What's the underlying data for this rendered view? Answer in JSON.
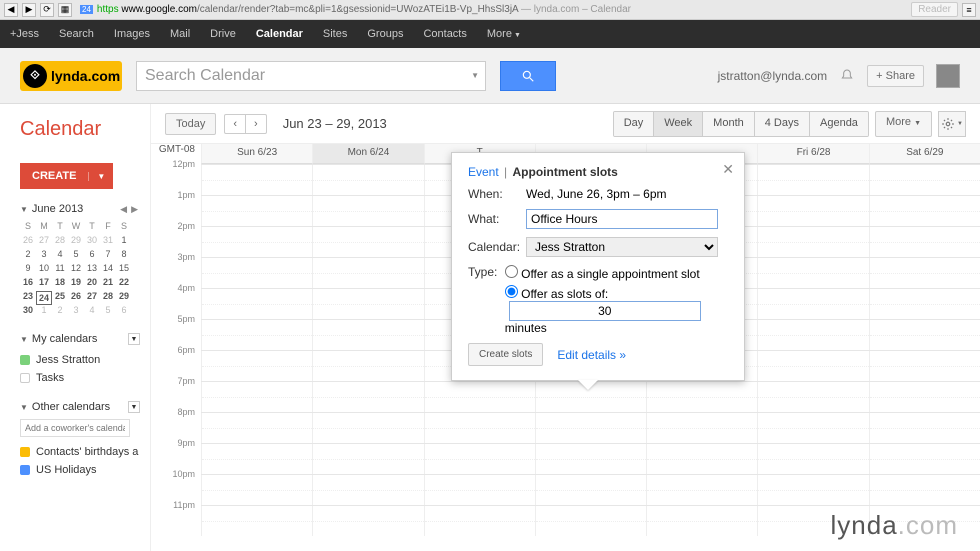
{
  "chrome": {
    "back": "◀",
    "fwd": "▶",
    "reload": "⟳",
    "grid": "▦",
    "favicon": "24",
    "https_label": "https",
    "host": "www.google.com",
    "path": "/calendar/render?tab=mc&pli=1&gsessionid=UWozATEi1B-Vp_HhsSl3jA",
    "title_suffix": " — lynda.com – Calendar",
    "reader": "Reader",
    "menu": "≡"
  },
  "gbar": {
    "items": [
      "+Jess",
      "Search",
      "Images",
      "Mail",
      "Drive",
      "Calendar",
      "Sites",
      "Groups",
      "Contacts"
    ],
    "more": "More"
  },
  "header": {
    "logo_text": "lynda.com",
    "search_placeholder": "Search Calendar",
    "email": "jstratton@lynda.com",
    "share": "+  Share"
  },
  "sidebar": {
    "title": "Calendar",
    "create_label": "CREATE",
    "month_label": "June 2013",
    "dow": [
      "S",
      "M",
      "T",
      "W",
      "T",
      "F",
      "S"
    ],
    "weeks": [
      [
        "26",
        "27",
        "28",
        "29",
        "30",
        "31",
        "1"
      ],
      [
        "2",
        "3",
        "4",
        "5",
        "6",
        "7",
        "8"
      ],
      [
        "9",
        "10",
        "11",
        "12",
        "13",
        "14",
        "15"
      ],
      [
        "16",
        "17",
        "18",
        "19",
        "20",
        "21",
        "22"
      ],
      [
        "23",
        "24",
        "25",
        "26",
        "27",
        "28",
        "29"
      ],
      [
        "30",
        "1",
        "2",
        "3",
        "4",
        "5",
        "6"
      ]
    ],
    "my_cals_label": "My calendars",
    "my_cals": [
      {
        "name": "Jess Stratton",
        "color": "#7bd17b",
        "checked": true
      },
      {
        "name": "Tasks",
        "color": "#ffffff",
        "checked": false
      }
    ],
    "other_cals_label": "Other calendars",
    "add_placeholder": "Add a coworker's calendar",
    "other_cals": [
      {
        "name": "Contacts' birthdays a",
        "color": "#fbbc05"
      },
      {
        "name": "US Holidays",
        "color": "#4d90fe"
      }
    ]
  },
  "toolbar": {
    "today": "Today",
    "prev": "‹",
    "next": "›",
    "range": "Jun 23 – 29, 2013",
    "views": [
      "Day",
      "Week",
      "Month",
      "4 Days",
      "Agenda"
    ],
    "more": "More"
  },
  "grid": {
    "tz": "GMT-08",
    "days": [
      "Sun 6/23",
      "Mon 6/24",
      "T",
      "",
      "",
      "Fri 6/28",
      "Sat 6/29"
    ],
    "hours": [
      "12pm",
      "1pm",
      "2pm",
      "3pm",
      "4pm",
      "5pm",
      "6pm",
      "7pm",
      "8pm",
      "9pm",
      "10pm",
      "11pm"
    ]
  },
  "popup": {
    "event_tab": "Event",
    "slots_tab": "Appointment slots",
    "sep": "|",
    "when_label": "When:",
    "when_value": "Wed, June 26, 3pm – 6pm",
    "what_label": "What:",
    "what_value": "Office Hours",
    "cal_label": "Calendar:",
    "cal_value": "Jess Stratton",
    "type_label": "Type:",
    "type_single": "Offer as a single appointment slot",
    "type_slots_pre": "Offer as slots of:",
    "slot_minutes": "30",
    "type_slots_post": "minutes",
    "create": "Create slots",
    "edit": "Edit details »"
  },
  "watermark": {
    "a": "lynda",
    "b": ".com"
  }
}
